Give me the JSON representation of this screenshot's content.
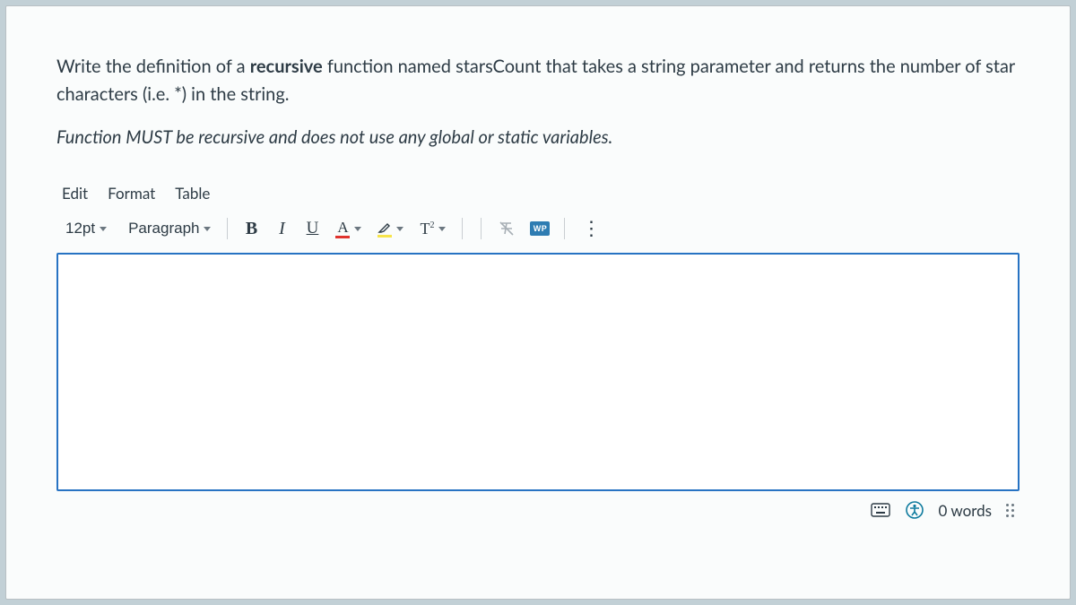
{
  "question": {
    "line1_pre": "Write the definition of a ",
    "bold1": "recursive",
    "line1_mid": " function named ",
    "func_name": "starsCount",
    "line1_post": " that takes a string parameter and returns the number of star",
    "line2": "characters (i.e. *) in the string.",
    "note": "Function MUST be recursive and does not use any global or static variables."
  },
  "menu": {
    "edit": "Edit",
    "format": "Format",
    "table": "Table"
  },
  "toolbar": {
    "font_size": "12pt",
    "block": "Paragraph",
    "bold": "B",
    "italic": "I",
    "underline": "U",
    "text_color_glyph": "A",
    "superscript_glyph": "T",
    "wp_badge": "WP"
  },
  "status": {
    "word_count": "0 words"
  }
}
